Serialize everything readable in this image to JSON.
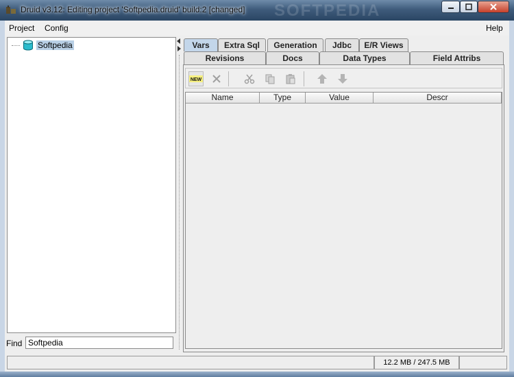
{
  "window": {
    "title": "Druid v3.12: Editing project 'Softpedia.druid' build:2 [changed]",
    "watermark": "SOFTPEDIA"
  },
  "menubar": {
    "project": "Project",
    "config": "Config",
    "help": "Help"
  },
  "tree": {
    "root_label": "Softpedia"
  },
  "find": {
    "label": "Find",
    "value": "Softpedia"
  },
  "tabs": {
    "row1": [
      "Vars",
      "Extra Sql",
      "Generation",
      "Jdbc",
      "E/R Views"
    ],
    "row2": [
      "Revisions",
      "Docs",
      "Data Types",
      "Field Attribs"
    ],
    "active": "Vars"
  },
  "toolbar": {
    "new_label": "NEW",
    "icons": [
      "new-icon",
      "delete-icon",
      "cut-icon",
      "copy-icon",
      "paste-icon",
      "up-arrow-icon",
      "down-arrow-icon"
    ]
  },
  "grid": {
    "columns": [
      "Name",
      "Type",
      "Value",
      "Descr"
    ]
  },
  "status": {
    "memory": "12.2 MB / 247.5 MB"
  },
  "colors": {
    "active_tab": "#c3d6ea",
    "selection": "#b8cfe5"
  }
}
